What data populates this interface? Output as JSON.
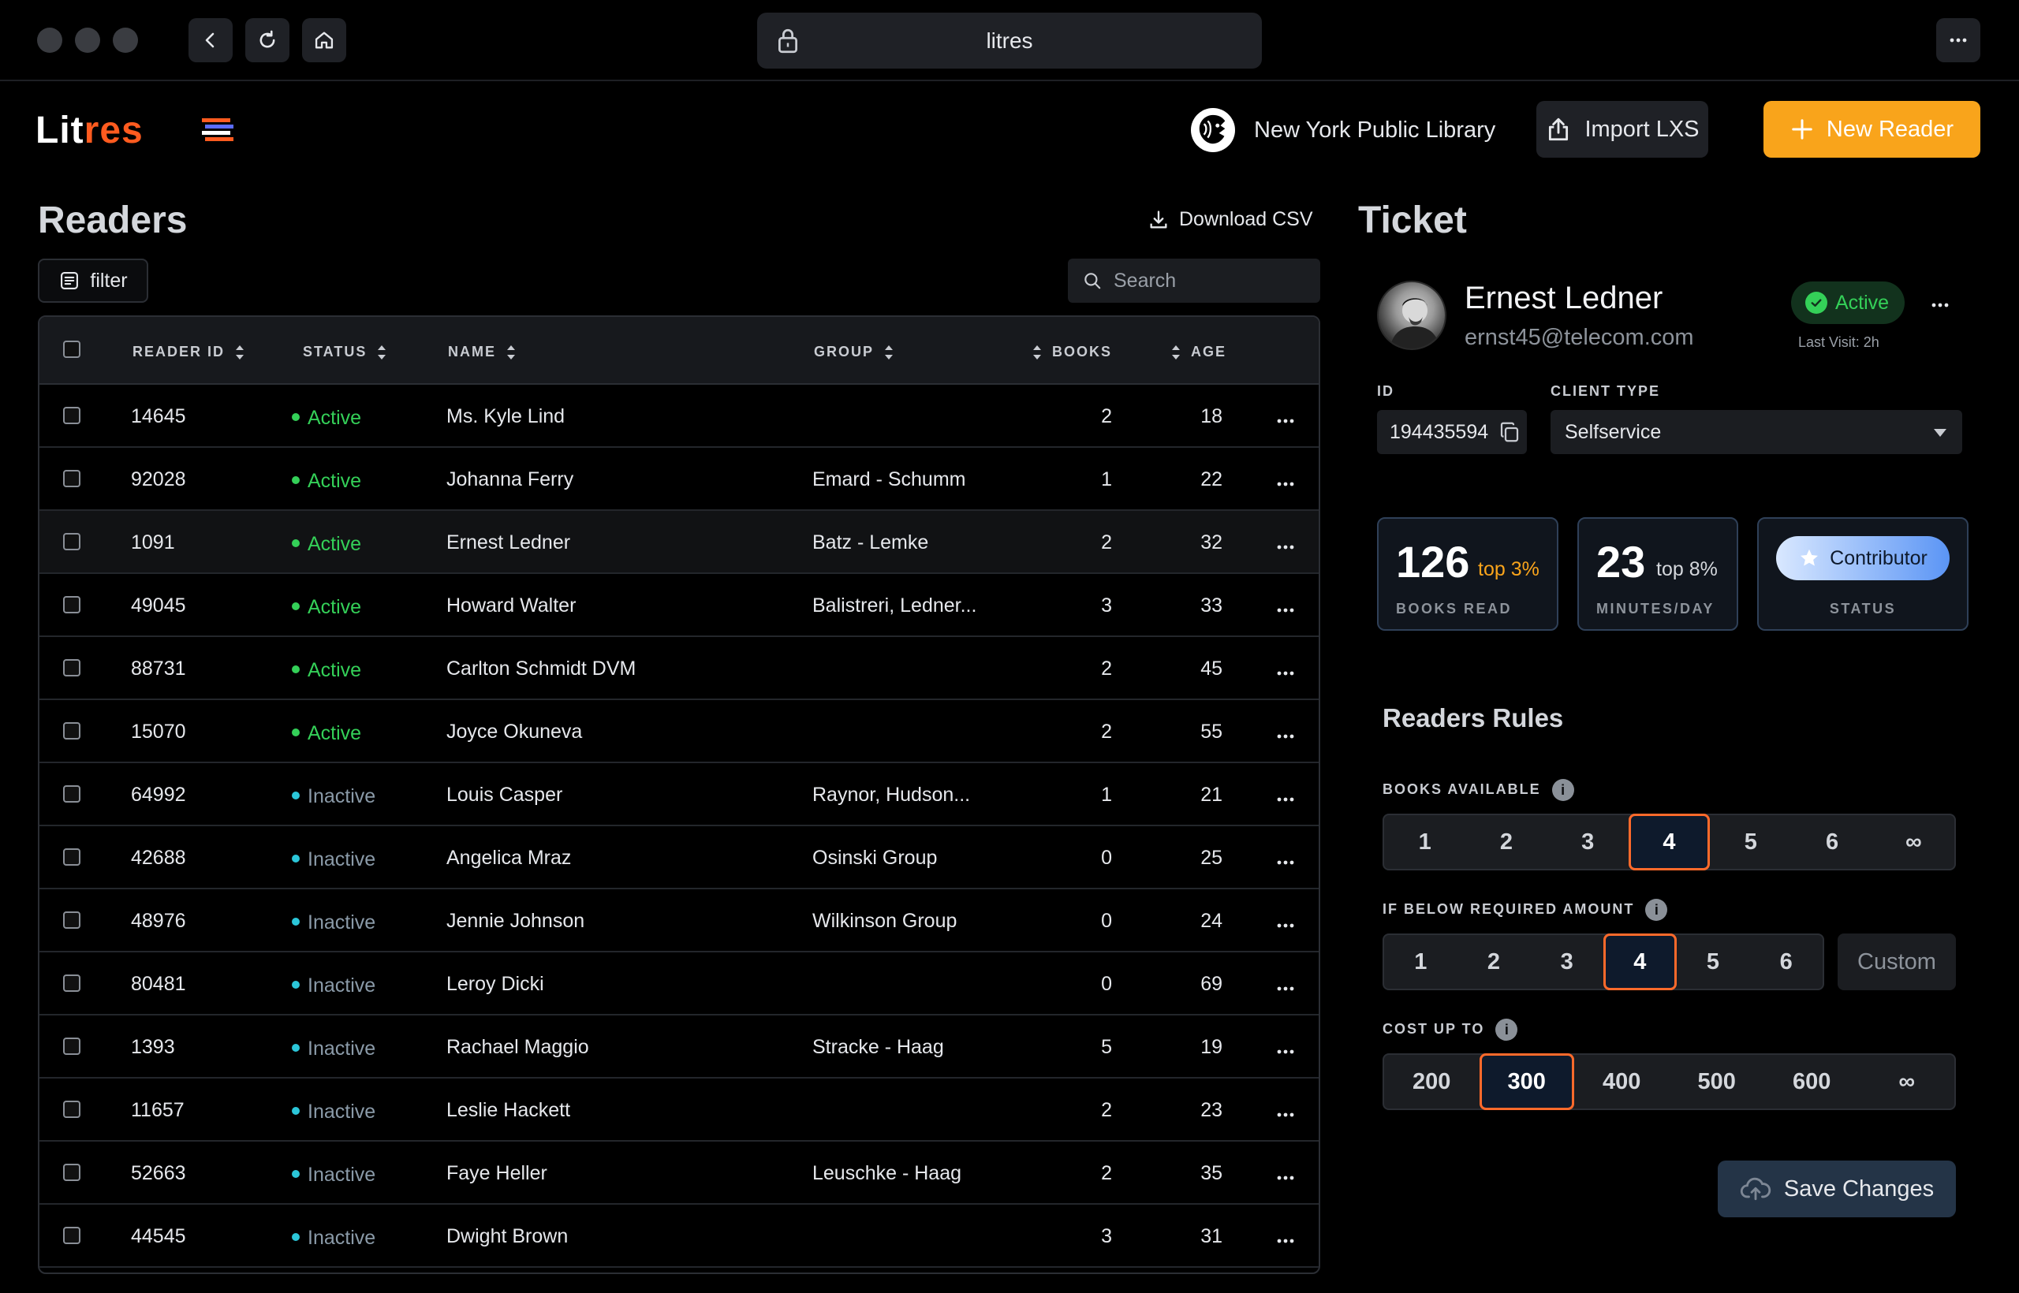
{
  "browser": {
    "url_text": "litres"
  },
  "header": {
    "logo_part1": "Lit",
    "logo_part2": "res",
    "organization": "New York Public Library",
    "import_label": "Import LXS",
    "new_reader_label": "New Reader",
    "accent_color": "#f9a41b"
  },
  "readers": {
    "title": "Readers",
    "download_label": "Download CSV",
    "filter_label": "filter",
    "search_placeholder": "Search",
    "columns": [
      "READER ID",
      "STATUS",
      "NAME",
      "GROUP",
      "BOOKS",
      "AGE"
    ],
    "rows": [
      {
        "id": "14645",
        "status": "Active",
        "name": "Ms. Kyle Lind",
        "group": "",
        "books": "2",
        "age": "18"
      },
      {
        "id": "92028",
        "status": "Active",
        "name": "Johanna Ferry",
        "group": "Emard - Schumm",
        "books": "1",
        "age": "22"
      },
      {
        "id": "1091",
        "status": "Active",
        "name": "Ernest Ledner",
        "group": "Batz - Lemke",
        "books": "2",
        "age": "32"
      },
      {
        "id": "49045",
        "status": "Active",
        "name": "Howard Walter",
        "group": "Balistreri, Ledner...",
        "books": "3",
        "age": "33"
      },
      {
        "id": "88731",
        "status": "Active",
        "name": "Carlton Schmidt DVM",
        "group": "",
        "books": "2",
        "age": "45"
      },
      {
        "id": "15070",
        "status": "Active",
        "name": "Joyce Okuneva",
        "group": "",
        "books": "2",
        "age": "55"
      },
      {
        "id": "64992",
        "status": "Inactive",
        "name": "Louis Casper",
        "group": "Raynor, Hudson...",
        "books": "1",
        "age": "21"
      },
      {
        "id": "42688",
        "status": "Inactive",
        "name": "Angelica Mraz",
        "group": "Osinski Group",
        "books": "0",
        "age": "25"
      },
      {
        "id": "48976",
        "status": "Inactive",
        "name": "Jennie Johnson",
        "group": "Wilkinson Group",
        "books": "0",
        "age": "24"
      },
      {
        "id": "80481",
        "status": "Inactive",
        "name": "Leroy Dicki",
        "group": "",
        "books": "0",
        "age": "69"
      },
      {
        "id": "1393",
        "status": "Inactive",
        "name": "Rachael Maggio",
        "group": "Stracke - Haag",
        "books": "5",
        "age": "19"
      },
      {
        "id": "11657",
        "status": "Inactive",
        "name": "Leslie Hackett",
        "group": "",
        "books": "2",
        "age": "23"
      },
      {
        "id": "52663",
        "status": "Inactive",
        "name": "Faye Heller",
        "group": "Leuschke - Haag",
        "books": "2",
        "age": "35"
      },
      {
        "id": "44545",
        "status": "Inactive",
        "name": "Dwight Brown",
        "group": "",
        "books": "3",
        "age": "31"
      }
    ],
    "selected_row": 2
  },
  "ticket": {
    "title": "Ticket",
    "name": "Ernest Ledner",
    "email": "ernst45@telecom.com",
    "status": "Active",
    "last_visit": "Last Visit: 2h",
    "id_label": "ID",
    "id_value": "194435594",
    "client_type_label": "CLIENT TYPE",
    "client_type_value": "Selfservice",
    "stats": {
      "books_read": "126",
      "books_read_rank": "top 3%",
      "books_read_caption": "BOOKS READ",
      "minutes": "23",
      "minutes_rank": "top 8%",
      "minutes_caption": "MINUTES/DAY",
      "status_badge": "Contributor",
      "status_caption": "STATUS"
    }
  },
  "rules": {
    "title": "Readers Rules",
    "books_available": {
      "label": "BOOKS AVAILABLE",
      "options": [
        "1",
        "2",
        "3",
        "4",
        "5",
        "6",
        "∞"
      ],
      "selected": "4"
    },
    "if_below": {
      "label": "IF BELOW REQUIRED AMOUNT",
      "options": [
        "1",
        "2",
        "3",
        "4",
        "5",
        "6"
      ],
      "selected": "4",
      "custom_label": "Custom"
    },
    "cost_up_to": {
      "label": "COST UP TO",
      "options": [
        "200",
        "300",
        "400",
        "500",
        "600",
        "∞"
      ],
      "selected": "300"
    },
    "save_label": "Save Changes"
  }
}
